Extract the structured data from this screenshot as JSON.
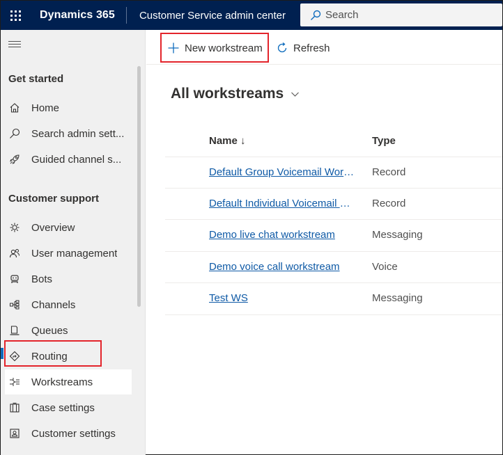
{
  "topbar": {
    "brand": "Dynamics 365",
    "app_name": "Customer Service admin center",
    "search_placeholder": "Search",
    "bg_color": "#002050"
  },
  "sidebar": {
    "sections": [
      {
        "title": "Get started",
        "items": [
          {
            "label": "Home",
            "icon": "home-icon"
          },
          {
            "label": "Search admin sett...",
            "icon": "search-icon"
          },
          {
            "label": "Guided channel s...",
            "icon": "rocket-icon"
          }
        ]
      },
      {
        "title": "Customer support",
        "items": [
          {
            "label": "Overview",
            "icon": "overview-icon"
          },
          {
            "label": "User management",
            "icon": "user-management-icon"
          },
          {
            "label": "Bots",
            "icon": "bot-icon"
          },
          {
            "label": "Channels",
            "icon": "channels-icon"
          },
          {
            "label": "Queues",
            "icon": "queues-icon"
          },
          {
            "label": "Routing",
            "icon": "routing-icon"
          },
          {
            "label": "Workstreams",
            "icon": "workstreams-icon",
            "selected": true
          },
          {
            "label": "Case settings",
            "icon": "case-settings-icon"
          },
          {
            "label": "Customer settings",
            "icon": "customer-settings-icon"
          }
        ]
      }
    ]
  },
  "commandbar": {
    "new_label": "New workstream",
    "refresh_label": "Refresh"
  },
  "main": {
    "view_title": "All workstreams",
    "columns": {
      "name": "Name ↓",
      "type": "Type"
    },
    "rows": [
      {
        "name": "Default Group Voicemail Work...",
        "type": "Record"
      },
      {
        "name": "Default Individual Voicemail W...",
        "type": "Record"
      },
      {
        "name": "Demo live chat workstream",
        "type": "Messaging"
      },
      {
        "name": "Demo voice call workstream",
        "type": "Voice"
      },
      {
        "name": "Test WS",
        "type": "Messaging"
      }
    ]
  },
  "colors": {
    "accent": "#0f6cbd",
    "highlight_box": "#e3242b",
    "link": "#0f5aa6"
  }
}
